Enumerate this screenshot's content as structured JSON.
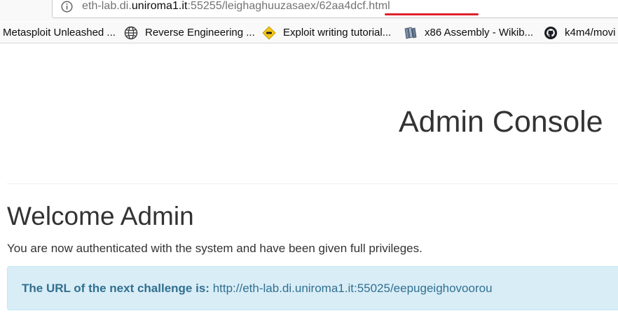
{
  "address_bar": {
    "url_prefix": "eth-lab.di.",
    "url_domain": "uniroma1.it",
    "url_path": ":55255/leighaghuuzasaex/",
    "url_file": "62aa4dcf.html"
  },
  "bookmarks": [
    {
      "label": "Metasploit Unleashed ...",
      "icon": "none"
    },
    {
      "label": "Reverse Engineering ...",
      "icon": "globe-icon"
    },
    {
      "label": "Exploit writing tutorial...",
      "icon": "yellow-diamond-icon"
    },
    {
      "label": "x86 Assembly - Wikib...",
      "icon": "books-icon"
    },
    {
      "label": "k4m4/movi",
      "icon": "github-icon"
    }
  ],
  "page": {
    "console_title": "Admin Console",
    "welcome_heading": "Welcome Admin",
    "welcome_text": "You are now authenticated with the system and have been given full privileges.",
    "alert_label": "The URL of the next challenge is:",
    "alert_url": "http://eth-lab.di.uniroma1.it:55025/eepugeighovoorou"
  },
  "colors": {
    "alert_bg": "#d9edf7",
    "alert_text": "#31708f",
    "url_highlight": "#e0202a"
  }
}
